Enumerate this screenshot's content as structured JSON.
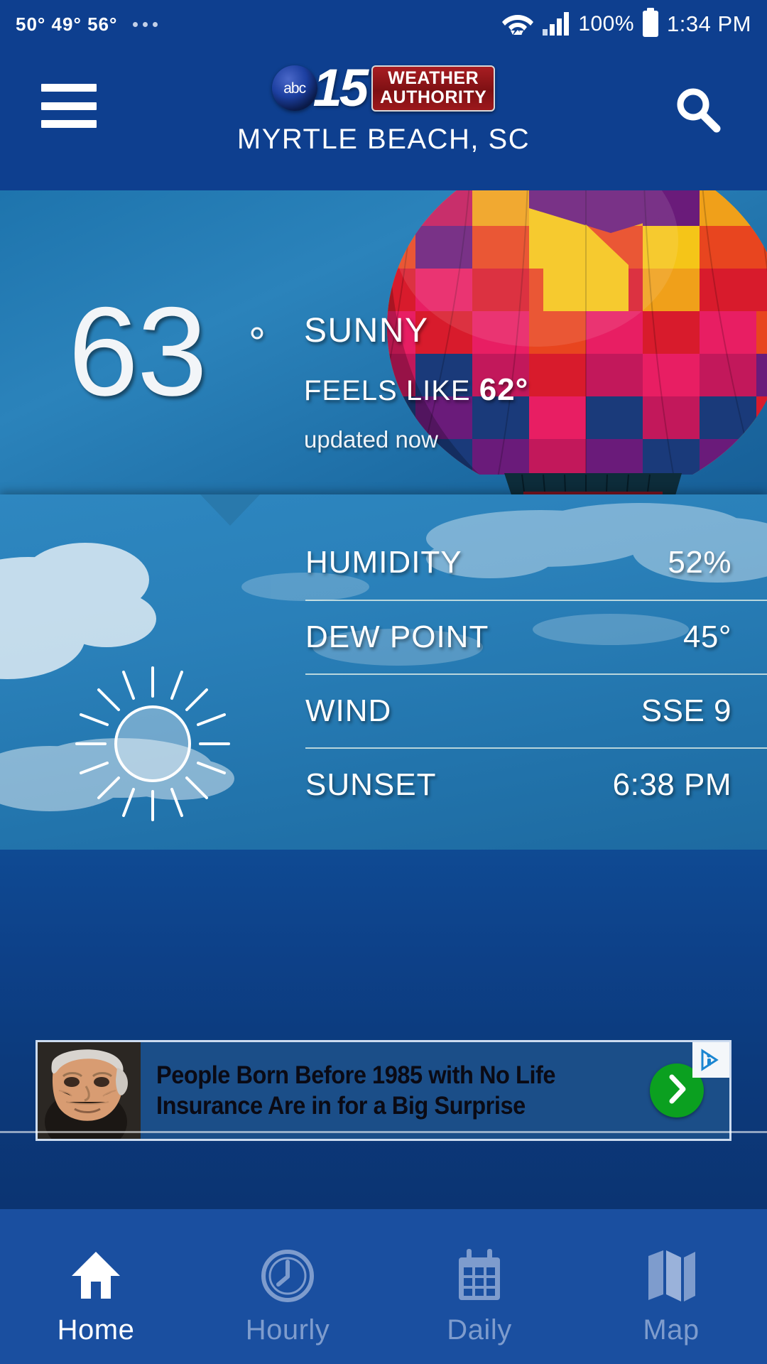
{
  "status_bar": {
    "temps": "50°  49°  56°",
    "overflow_icon": "more-dots-icon",
    "wifi_icon": "wifi-icon",
    "signal_icon": "cell-signal-icon",
    "battery_percent": "100%",
    "battery_icon": "battery-full-icon",
    "time": "1:34 PM"
  },
  "header": {
    "menu_icon": "hamburger-menu-icon",
    "search_icon": "search-icon",
    "logo": {
      "network": "abc",
      "channel": "15",
      "badge_line1": "WEATHER",
      "badge_line2": "AUTHORITY"
    },
    "city": "MYRTLE BEACH, SC"
  },
  "current": {
    "temperature": "63",
    "degree": "°",
    "condition": "SUNNY",
    "feels_like_label": "FEELS LIKE",
    "feels_like_value": "62°",
    "updated": "updated now",
    "hero_image": "hot-air-balloon-photo"
  },
  "details": {
    "condition_icon": "sun-icon",
    "rows": [
      {
        "label": "HUMIDITY",
        "value": "52%"
      },
      {
        "label": "DEW POINT",
        "value": "45°"
      },
      {
        "label": "WIND",
        "value": "SSE 9"
      },
      {
        "label": "SUNSET",
        "value": "6:38 PM"
      }
    ]
  },
  "ad": {
    "image": "elderly-man-photo",
    "headline_line1": "People Born Before 1985 with No Life",
    "headline_line2": "Insurance Are in for a Big Surprise",
    "cta_icon": "chevron-right-icon",
    "adchoices_icon": "adchoices-icon"
  },
  "bottom_nav": {
    "items": [
      {
        "label": "Home",
        "icon": "home-icon",
        "active": true
      },
      {
        "label": "Hourly",
        "icon": "clock-icon",
        "active": false
      },
      {
        "label": "Daily",
        "icon": "calendar-icon",
        "active": false
      },
      {
        "label": "Map",
        "icon": "map-icon",
        "active": false
      }
    ]
  },
  "colors": {
    "header_blue": "#0e3f8f",
    "nav_blue": "#1a4fa0",
    "panel_blue": "#2a80b9",
    "badge_red": "#9c181c",
    "cta_green": "#0ba020",
    "inactive_nav": "#7e9ccd"
  }
}
